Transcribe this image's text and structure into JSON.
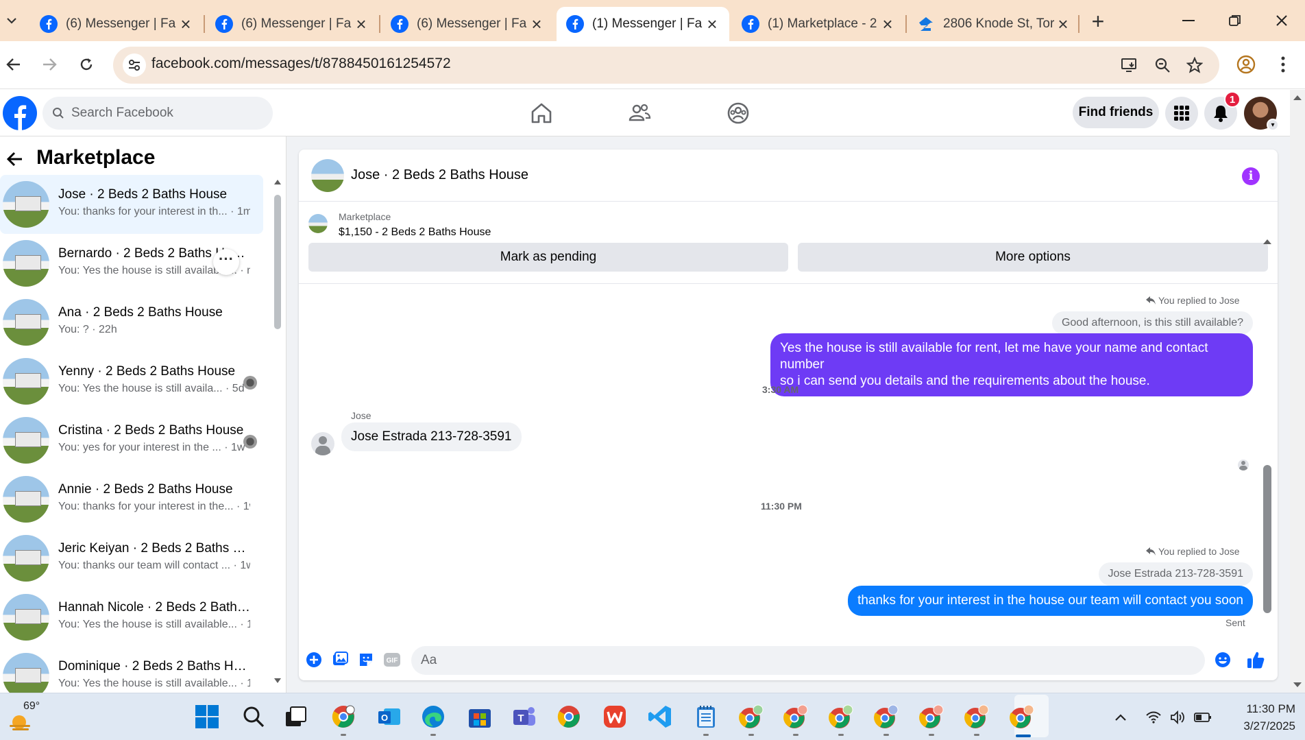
{
  "browser": {
    "tabs": [
      {
        "title": "(6) Messenger | Fa",
        "active": false
      },
      {
        "title": "(6) Messenger | Fa",
        "active": false
      },
      {
        "title": "(6) Messenger | Fa",
        "active": false
      },
      {
        "title": "(1) Messenger | Fa",
        "active": true
      },
      {
        "title": "(1) Marketplace - 2",
        "active": false
      },
      {
        "title": "2806 Knode St, Tor",
        "active": false
      }
    ],
    "url": "facebook.com/messages/t/8788450161254572"
  },
  "fb": {
    "search_placeholder": "Search Facebook",
    "find_friends": "Find friends",
    "notif_count": "1"
  },
  "sidebar": {
    "title": "Marketplace",
    "conversations": [
      {
        "name": "Jose · 2 Beds 2 Baths House",
        "snippet": "You: thanks for your interest in th...",
        "time": "1m"
      },
      {
        "name": "Bernardo · 2 Beds 2 Baths House",
        "snippet": "You: Yes the house is still available...",
        "time": "m"
      },
      {
        "name": "Ana · 2 Beds 2 Baths House",
        "snippet": "You: ?",
        "time": "22h"
      },
      {
        "name": "Yenny · 2 Beds 2 Baths House",
        "snippet": "You: Yes the house is still availa...",
        "time": "5d"
      },
      {
        "name": "Cristina · 2 Beds 2 Baths House",
        "snippet": "You: yes for your interest in the ...",
        "time": "1w"
      },
      {
        "name": "Annie · 2 Beds 2 Baths House",
        "snippet": "You: thanks for your interest in the...",
        "time": "1w"
      },
      {
        "name": "Jeric Keiyan · 2 Beds 2 Baths Ho...",
        "snippet": "You: thanks our team will contact ...",
        "time": "1w"
      },
      {
        "name": "Hannah Nicole · 2 Beds 2 Baths ...",
        "snippet": "You: Yes the house is still available...",
        "time": "1w"
      },
      {
        "name": "Dominique · 2 Beds 2 Baths Ho...",
        "snippet": "You: Yes the house is still available...",
        "time": "1w"
      }
    ]
  },
  "chat": {
    "title": "Jose · 2 Beds 2 Baths House",
    "marketplace_label": "Marketplace",
    "listing": "$1,150 - 2 Beds 2 Baths House",
    "mark_pending": "Mark as pending",
    "more_options": "More options",
    "replied_label": "You replied to Jose",
    "quoted_1": "Good afternoon, is this still available?",
    "msg_out_1_line1": "Yes the house is still available for rent, let me have your name and  contact number",
    "msg_out_1_line2": "so i can send you details and the requirements about the house.",
    "time_1": "3:30 AM",
    "sender_name": "Jose",
    "msg_in_1": "Jose Estrada 213-728-3591",
    "time_2": "11:30 PM",
    "quoted_2": "Jose Estrada 213-728-3591",
    "msg_out_2": "thanks for your interest in the house our team will contact you soon",
    "sent_status": "Sent",
    "composer_placeholder": "Aa",
    "gif_label": "GIF"
  },
  "taskbar": {
    "temp": "69°",
    "time": "11:30 PM",
    "date": "3/27/2025"
  },
  "colors": {
    "fb_blue": "#0866ff",
    "bubble_purple": "#6e3bf5",
    "bubble_blue": "#0a7cff",
    "tabstrip": "#f9e2cc"
  }
}
